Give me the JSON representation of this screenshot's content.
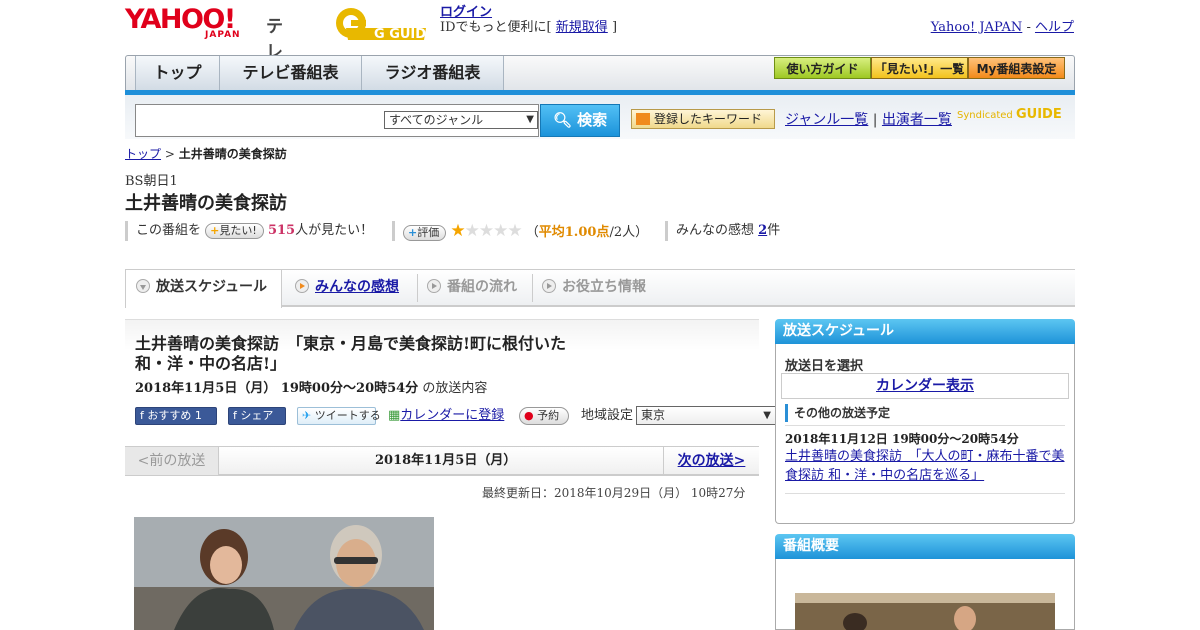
{
  "header": {
    "logo_text": "YAHOO!",
    "logo_sub": "JAPAN",
    "logo_service": "テレビ",
    "gguide_logo": "G GUIDE",
    "login_label": "ログイン",
    "login_note_prefix": "IDでもっと便利に[",
    "signup_label": "新規取得",
    "login_note_suffix": "]",
    "yahoo_japan_link": "Yahoo! JAPAN",
    "link_sep": " - ",
    "help_link": "ヘルプ"
  },
  "nav": {
    "tabs": [
      {
        "label": "トップ"
      },
      {
        "label": "テレビ番組表"
      },
      {
        "label": "ラジオ番組表"
      }
    ],
    "right_buttons": [
      {
        "label": "使い方ガイド"
      },
      {
        "label": "「見たい!」一覧"
      },
      {
        "label": "My番組表設定"
      }
    ]
  },
  "search": {
    "input_value": "",
    "genre_selected": "すべてのジャンル",
    "search_button": "検索",
    "keyword_button": "登録したキーワード",
    "genre_link": "ジャンル一覧",
    "link_sep": "|",
    "cast_link": "出演者一覧",
    "syndicated_label": "Syndicated",
    "syndicated_logo": "GUIDE"
  },
  "breadcrumb": {
    "home": "トップ",
    "sep": " > ",
    "current": "土井善晴の美食探訪"
  },
  "program": {
    "channel": "BS朝日1",
    "title": "土井善晴の美食探訪",
    "want_prefix": "この番組を",
    "want_button": "見たい!",
    "want_count": "515",
    "want_suffix": "人が見たい！",
    "rate_button": "評価",
    "rating": 1,
    "rating_max": 5,
    "avg_open": "（",
    "avg_text": "平均1.00点",
    "avg_count": "/2人",
    "avg_close": "）",
    "reviews_prefix": "みんなの感想",
    "reviews_count": "2",
    "reviews_suffix": "件"
  },
  "tabs": [
    {
      "label": "放送スケジュール",
      "active": true
    },
    {
      "label": "みんなの感想",
      "link": true
    },
    {
      "label": "番組の流れ"
    },
    {
      "label": "お役立ち情報"
    }
  ],
  "episode": {
    "title": "土井善晴の美食探訪　「東京・月島で美食探訪!町に根付いた和・洋・中の名店!」",
    "datetime": "2018年11月5日（月）  19時00分～20時54分",
    "datetime_suffix": "の放送内容",
    "recommend_button": "おすすめ",
    "recommend_count": "1",
    "share_button": "シェア",
    "tweet_button": "ツイートする",
    "calendar_link": "カレンダーに登録",
    "reserve_button": "予約",
    "region_label": "地域設定",
    "region_selected": "東京"
  },
  "pager": {
    "prev": "<前の放送",
    "date": "2018年11月5日（月）",
    "next": "次の放送>"
  },
  "updated": "最終更新日：2018年10月29日（月）  10時27分",
  "sidebar": {
    "schedule_head": "放送スケジュール",
    "select_day": "放送日を選択",
    "calendar_button": "カレンダー表示",
    "other_head": "その他の放送予定",
    "other_date": "2018年11月12日  19時00分～20時54分",
    "other_link": "土井善晴の美食探訪　「大人の町・麻布十番で美食探訪 和・洋・中の名店を巡る」",
    "overview_head": "番組概要"
  },
  "colors": {
    "accent_blue": "#1f8fd9",
    "yahoo_red": "#e0001b",
    "rating_orange": "#f5a500"
  }
}
